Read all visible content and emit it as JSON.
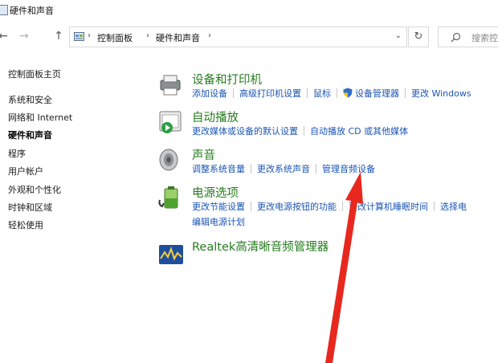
{
  "window": {
    "title": "硬件和声音"
  },
  "nav": {
    "back_glyph": "←",
    "forward_glyph": "→",
    "up_glyph": "↑",
    "breadcrumb": [
      "控制面板",
      "硬件和声音"
    ],
    "dropdown_glyph": "⌄",
    "refresh_glyph": "↻",
    "search_placeholder": "搜索控制"
  },
  "sidebar": {
    "home": "控制面板主页",
    "items": [
      {
        "label": "系统和安全",
        "active": false
      },
      {
        "label": "网络和 Internet",
        "active": false
      },
      {
        "label": "硬件和声音",
        "active": true
      },
      {
        "label": "程序",
        "active": false
      },
      {
        "label": "用户帐户",
        "active": false
      },
      {
        "label": "外观和个性化",
        "active": false
      },
      {
        "label": "时钟和区域",
        "active": false
      },
      {
        "label": "轻松使用",
        "active": false
      }
    ]
  },
  "categories": [
    {
      "title": "设备和打印机",
      "icon": "printer-icon",
      "links": [
        "添加设备",
        "高级打印机设置",
        "鼠标",
        "设备管理器",
        "更改 Windows"
      ]
    },
    {
      "title": "自动播放",
      "icon": "autoplay-icon",
      "links": [
        "更改媒体或设备的默认设置",
        "自动播放 CD 或其他媒体"
      ]
    },
    {
      "title": "声音",
      "icon": "speaker-icon",
      "links": [
        "调整系统音量",
        "更改系统声音",
        "管理音频设备"
      ]
    },
    {
      "title": "电源选项",
      "icon": "battery-icon",
      "links": [
        "更改节能设置",
        "更改电源按钮的功能",
        "更改计算机睡眠时间",
        "选择电",
        "编辑电源计划"
      ]
    },
    {
      "title": "Realtek高清晰音频管理器",
      "icon": "realtek-audio-icon",
      "links": []
    }
  ],
  "colors": {
    "category_title": "#267c1f",
    "link": "#1a55b5",
    "annotation_arrow": "#e8281e"
  }
}
